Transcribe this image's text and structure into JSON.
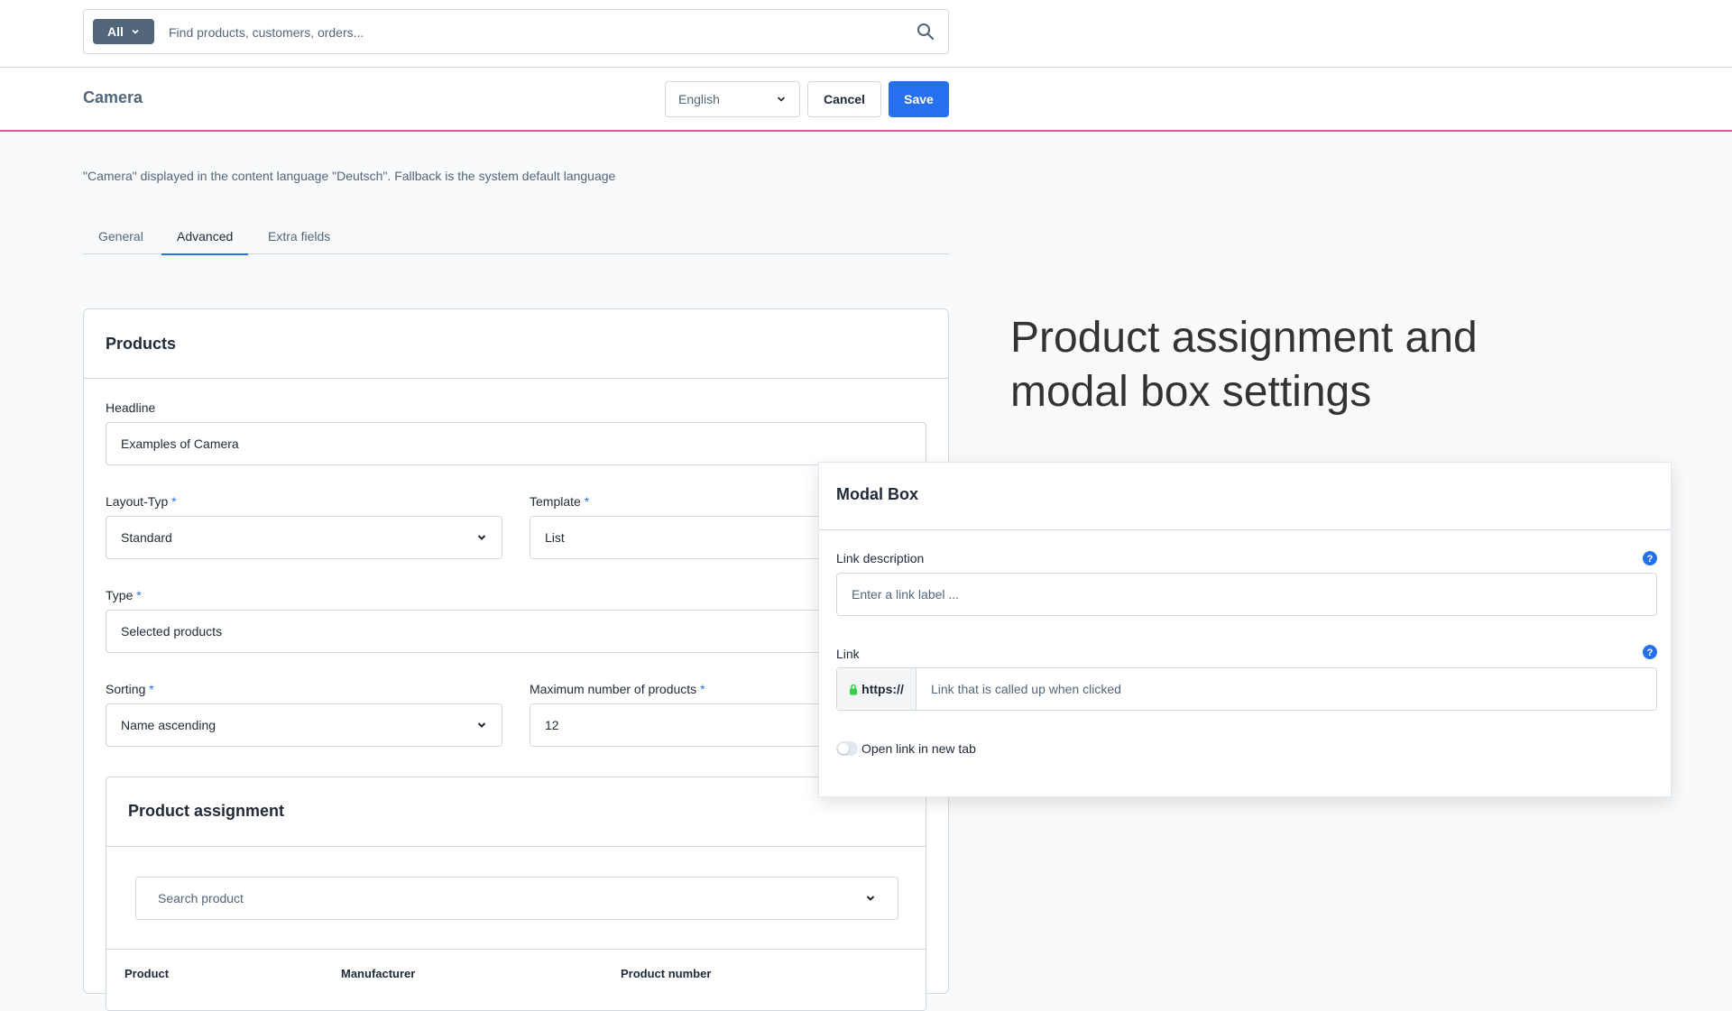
{
  "search": {
    "scope": "All",
    "placeholder": "Find products, customers, orders..."
  },
  "header": {
    "title": "Camera",
    "language": "English",
    "cancel_label": "Cancel",
    "save_label": "Save"
  },
  "language_info": "\"Camera\" displayed in the content language \"Deutsch\". Fallback is the system default language",
  "tabs": [
    {
      "label": "General",
      "active": false
    },
    {
      "label": "Advanced",
      "active": true
    },
    {
      "label": "Extra fields",
      "active": false
    }
  ],
  "products_card": {
    "title": "Products",
    "headline_label": "Headline",
    "headline_value": "Examples of Camera",
    "layout_label": "Layout-Typ",
    "layout_value": "Standard",
    "template_label": "Template",
    "template_value": "List",
    "type_label": "Type",
    "type_value": "Selected products",
    "sorting_label": "Sorting",
    "sorting_value": "Name ascending",
    "max_label": "Maximum number of products",
    "max_value": "12",
    "required_mark": "*"
  },
  "assignment": {
    "title": "Product assignment",
    "search_placeholder": "Search product",
    "columns": [
      "Product",
      "Manufacturer",
      "Product number"
    ]
  },
  "hero_text": "Product assignment and modal box settings",
  "modal": {
    "title": "Modal Box",
    "link_desc_label": "Link description",
    "link_desc_placeholder": "Enter a link label ...",
    "link_label": "Link",
    "link_prefix": "https://",
    "link_placeholder": "Link that is called up when clicked",
    "toggle_label": "Open link in new tab",
    "toggle_on": false,
    "help_symbol": "?"
  },
  "colors": {
    "primary": "#2670f0",
    "accent_line": "#e05c9b",
    "scope_bg": "#52667a"
  }
}
